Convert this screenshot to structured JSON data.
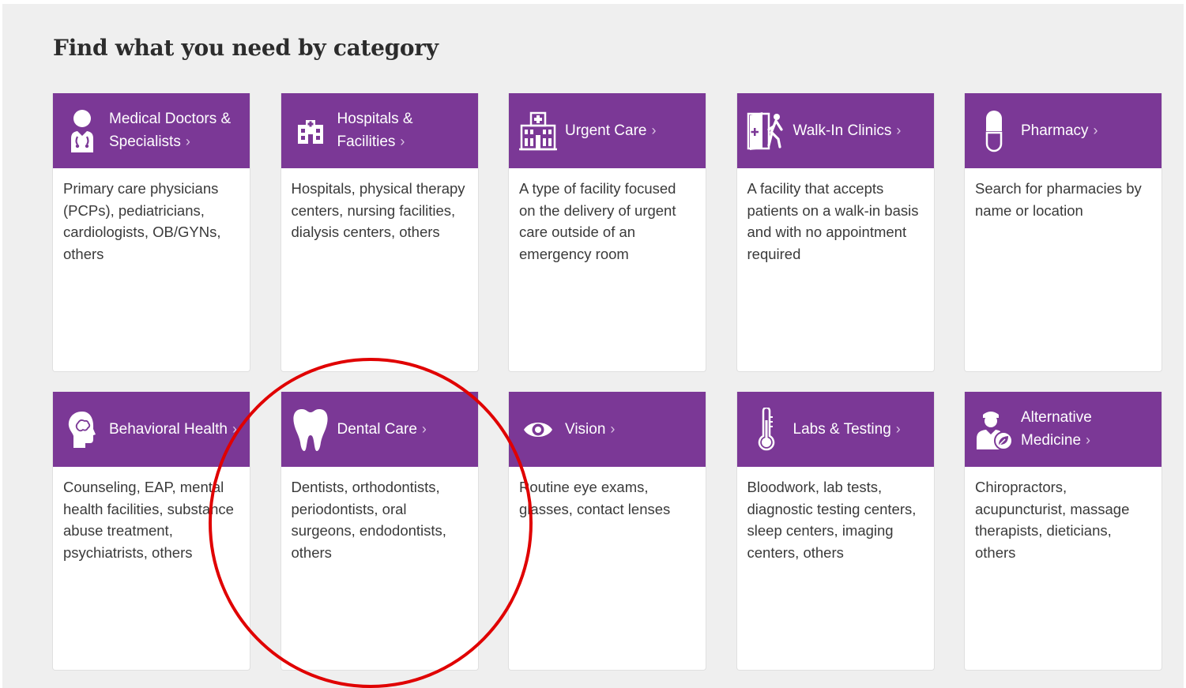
{
  "page": {
    "title": "Find what you need by category"
  },
  "accent": {
    "header_purple": "#7b3896",
    "annotation_red": "#e00000"
  },
  "categories": [
    {
      "label": "Medical Doctors & Specialists",
      "icon": "doctor-icon",
      "description": "Primary care physicians (PCPs), pediatricians, cardiologists, OB/GYNs, others"
    },
    {
      "label": "Hospitals & Facilities",
      "icon": "hospital-building-icon",
      "description": "Hospitals, physical therapy centers, nursing facilities, dialysis centers, others"
    },
    {
      "label": "Urgent Care",
      "icon": "urgent-care-building-icon",
      "description": "A type of facility focused on the delivery of urgent care outside of an emergency room"
    },
    {
      "label": "Walk-In Clinics",
      "icon": "walk-in-door-icon",
      "description": "A facility that accepts patients on a walk-in basis and with no appointment required"
    },
    {
      "label": "Pharmacy",
      "icon": "pill-capsule-icon",
      "description": "Search for pharmacies by name or location"
    },
    {
      "label": "Behavioral Health",
      "icon": "head-profile-icon",
      "description": "Counseling, EAP, mental health facilities, substance abuse treatment, psychiatrists, others"
    },
    {
      "label": "Dental Care",
      "icon": "tooth-icon",
      "description": "Dentists, orthodontists, periodontists, oral surgeons, endodontists, others"
    },
    {
      "label": "Vision",
      "icon": "eye-icon",
      "description": "Routine eye exams, glasses, contact lenses"
    },
    {
      "label": "Labs & Testing",
      "icon": "thermometer-icon",
      "description": "Bloodwork, lab tests, diagnostic testing centers, sleep centers, imaging centers, others"
    },
    {
      "label": "Alternative Medicine",
      "icon": "practitioner-leaf-icon",
      "description": "Chiropractors, acupuncturist, massage therapists, dieticians, others"
    }
  ]
}
